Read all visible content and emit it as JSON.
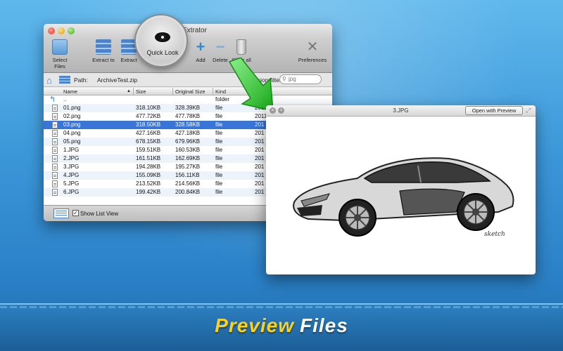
{
  "app": {
    "title": "Rar Extrator",
    "toolbar": [
      {
        "label": "Select Files",
        "icon": "folder-icon"
      },
      {
        "label": "Extract to",
        "icon": "stack-icon"
      },
      {
        "label": "Extract",
        "icon": "stack-icon"
      },
      {
        "label": "Add",
        "icon": "plus-icon"
      },
      {
        "label": "Delete",
        "icon": "minus-icon"
      },
      {
        "label": "Clear all",
        "icon": "trash-icon"
      },
      {
        "label": "Preferences",
        "icon": "tools-icon"
      }
    ],
    "quick_look": {
      "label": "Quick Look",
      "icon": "eye-icon"
    },
    "path": {
      "label": "Path:",
      "value": "ArchiveTest.zip"
    },
    "filter": {
      "label": "Extension filter :",
      "placeholder": "jpg"
    },
    "columns": [
      "Name",
      "Size",
      "Original Size",
      "Kind",
      "Date"
    ],
    "rows": [
      {
        "name": "..",
        "size": "",
        "orig": "",
        "kind": "folder",
        "date": ""
      },
      {
        "name": "01.png",
        "size": "318.10KB",
        "orig": "328.39KB",
        "kind": "file",
        "date": "2011-10-31 14:30"
      },
      {
        "name": "02.png",
        "size": "477.72KB",
        "orig": "477.78KB",
        "kind": "file",
        "date": "2011-10-31 14:30"
      },
      {
        "name": "03.png",
        "size": "318.50KB",
        "orig": "328.58KB",
        "kind": "file",
        "date": "201"
      },
      {
        "name": "04.png",
        "size": "427.16KB",
        "orig": "427.18KB",
        "kind": "file",
        "date": "201"
      },
      {
        "name": "05.png",
        "size": "678.15KB",
        "orig": "679.96KB",
        "kind": "file",
        "date": "201"
      },
      {
        "name": "1.JPG",
        "size": "159.51KB",
        "orig": "160.53KB",
        "kind": "file",
        "date": "201"
      },
      {
        "name": "2.JPG",
        "size": "161.51KB",
        "orig": "162.69KB",
        "kind": "file",
        "date": "201"
      },
      {
        "name": "3.JPG",
        "size": "194.28KB",
        "orig": "195.27KB",
        "kind": "file",
        "date": "201"
      },
      {
        "name": "4.JPG",
        "size": "155.09KB",
        "orig": "156.11KB",
        "kind": "file",
        "date": "201"
      },
      {
        "name": "5.JPG",
        "size": "213.52KB",
        "orig": "214.56KB",
        "kind": "file",
        "date": "201"
      },
      {
        "name": "6.JPG",
        "size": "199.42KB",
        "orig": "200.84KB",
        "kind": "file",
        "date": "201"
      }
    ],
    "selected_row": 3,
    "status": {
      "show_list_view": "Show List View",
      "checked": true
    }
  },
  "preview": {
    "title": "3.JPG",
    "open_button": "Open with Preview",
    "image_signature": "sketch"
  },
  "banner": {
    "word1": "Preview",
    "word2": "Files"
  },
  "colors": {
    "selection": "#3875d7",
    "banner_yellow": "#ffd21a",
    "arrow_green": "#3ccf3c"
  }
}
